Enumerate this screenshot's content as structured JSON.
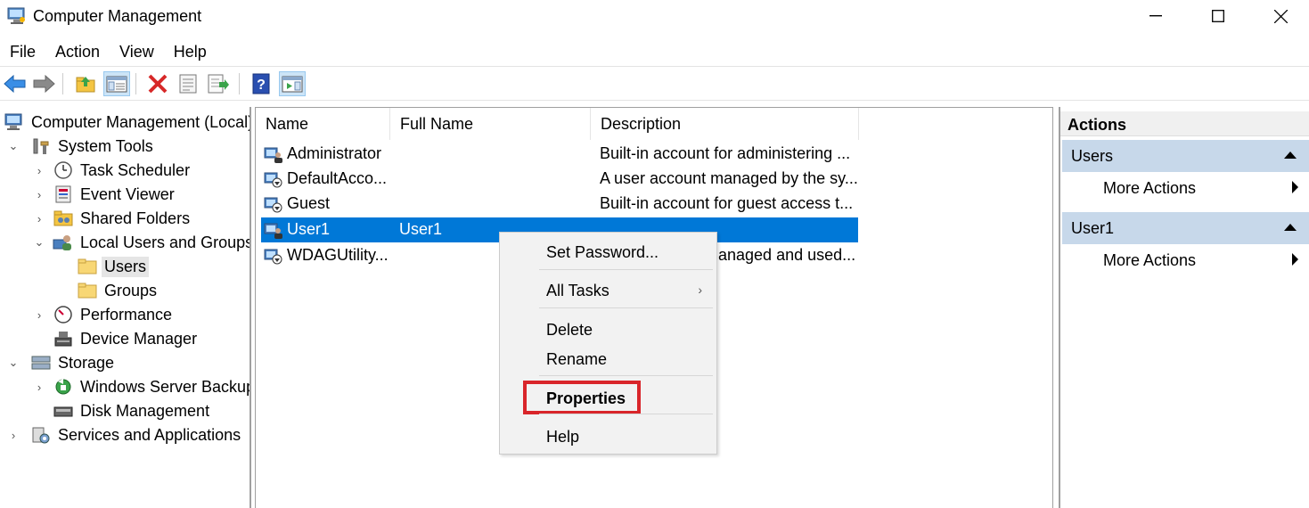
{
  "window": {
    "title": "Computer Management",
    "minimize": "—",
    "maximize": "☐",
    "close": "✕"
  },
  "menu": [
    "File",
    "Action",
    "View",
    "Help"
  ],
  "toolbar": [
    "back-icon",
    "forward-icon",
    "up-folder-icon",
    "show-hide-tree-icon",
    "delete-icon",
    "properties-icon",
    "export-list-icon",
    "help-icon",
    "show-hide-action-pane-icon"
  ],
  "tree": {
    "root": "Computer Management (Local)",
    "system_tools": "System Tools",
    "task_scheduler": "Task Scheduler",
    "event_viewer": "Event Viewer",
    "shared_folders": "Shared Folders",
    "local_users_groups": "Local Users and Groups",
    "users": "Users",
    "groups": "Groups",
    "performance": "Performance",
    "device_manager": "Device Manager",
    "storage": "Storage",
    "windows_server_backup": "Windows Server Backup",
    "disk_management": "Disk Management",
    "services_apps": "Services and Applications"
  },
  "list": {
    "columns": [
      "Name",
      "Full Name",
      "Description"
    ],
    "rows": [
      {
        "name": "Administrator",
        "full_name": "",
        "description": "Built-in account for administering ..."
      },
      {
        "name": "DefaultAcco...",
        "full_name": "",
        "description": "A user account managed by the sy..."
      },
      {
        "name": "Guest",
        "full_name": "",
        "description": "Built-in account for guest access t..."
      },
      {
        "name": "User1",
        "full_name": "User1",
        "description": ""
      },
      {
        "name": "WDAGUtility...",
        "full_name": "",
        "description": "anaged and used..."
      }
    ]
  },
  "context_menu": {
    "set_password": "Set Password...",
    "all_tasks": "All Tasks",
    "delete": "Delete",
    "rename": "Rename",
    "properties": "Properties",
    "help": "Help"
  },
  "actions": {
    "header": "Actions",
    "section1": "Users",
    "section1_item": "More Actions",
    "section2": "User1",
    "section2_item": "More Actions"
  },
  "colors": {
    "selection": "#0078d7",
    "section_bg": "#c7d8ea",
    "highlight_box": "#d9252a"
  }
}
